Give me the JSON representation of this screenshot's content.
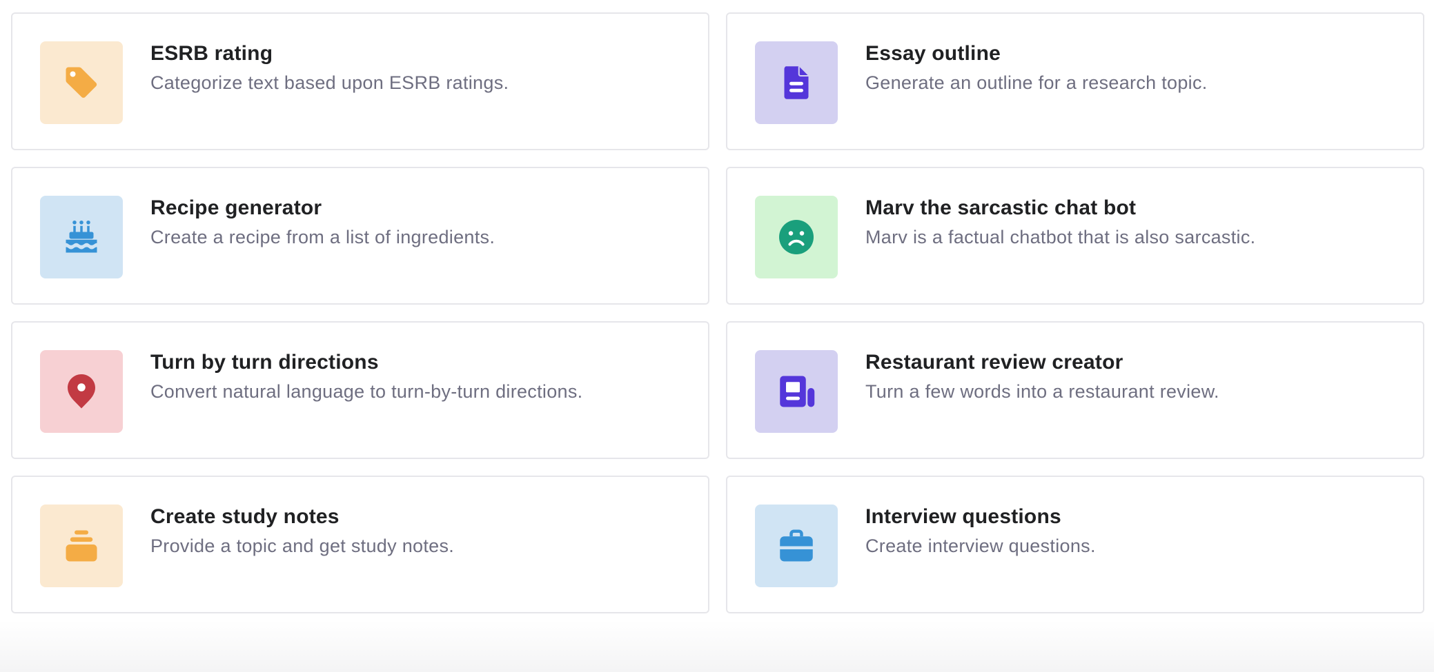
{
  "examples": [
    {
      "title": "ESRB rating",
      "description": "Categorize text based upon ESRB ratings.",
      "icon": "tag-icon",
      "tile_bg": "#fbe9d0",
      "icon_color": "#f4ac45"
    },
    {
      "title": "Essay outline",
      "description": "Generate an outline for a research topic.",
      "icon": "document-icon",
      "tile_bg": "#d3d0f1",
      "icon_color": "#5436da"
    },
    {
      "title": "Recipe generator",
      "description": "Create a recipe from a list of ingredients.",
      "icon": "cake-icon",
      "tile_bg": "#d0e4f4",
      "icon_color": "#3692d6"
    },
    {
      "title": "Marv the sarcastic chat bot",
      "description": "Marv is a factual chatbot that is also sarcastic.",
      "icon": "sad-face-icon",
      "tile_bg": "#d2f4d3",
      "icon_color": "#1a9f7c"
    },
    {
      "title": "Turn by turn directions",
      "description": "Convert natural language to turn-by-turn directions.",
      "icon": "map-pin-icon",
      "tile_bg": "#f7d0d3",
      "icon_color": "#c23a43"
    },
    {
      "title": "Restaurant review creator",
      "description": "Turn a few words into a restaurant review.",
      "icon": "newspaper-icon",
      "tile_bg": "#d3d0f1",
      "icon_color": "#5436da"
    },
    {
      "title": "Create study notes",
      "description": "Provide a topic and get study notes.",
      "icon": "stack-icon",
      "tile_bg": "#fbe9d0",
      "icon_color": "#f4ac45"
    },
    {
      "title": "Interview questions",
      "description": "Create interview questions.",
      "icon": "briefcase-icon",
      "tile_bg": "#d0e4f4",
      "icon_color": "#3692d6"
    }
  ]
}
